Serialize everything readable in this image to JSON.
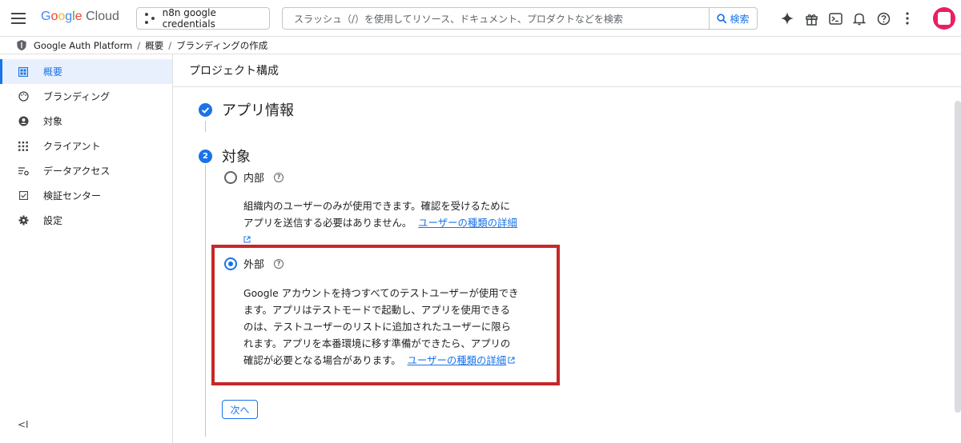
{
  "topbar": {
    "logo_google": "Google",
    "logo_cloud": "Cloud",
    "project": "n8n google credentials",
    "search_placeholder": "スラッシュ（/）を使用してリソース、ドキュメント、プロダクトなどを検索",
    "search_button": "検索"
  },
  "breadcrumb": [
    "Google Auth Platform",
    "概要",
    "ブランディングの作成"
  ],
  "sidebar": {
    "items": [
      {
        "label": "概要",
        "icon": "dashboard-icon"
      },
      {
        "label": "ブランディング",
        "icon": "palette-icon"
      },
      {
        "label": "対象",
        "icon": "person-icon"
      },
      {
        "label": "クライアント",
        "icon": "apps-grid-icon"
      },
      {
        "label": "データアクセス",
        "icon": "data-settings-icon"
      },
      {
        "label": "検証センター",
        "icon": "check-box-icon"
      },
      {
        "label": "設定",
        "icon": "gear-icon"
      }
    ],
    "collapse": "<I"
  },
  "main": {
    "header": "プロジェクト構成",
    "step1": {
      "title": "アプリ情報"
    },
    "step2": {
      "number": "2",
      "title": "対象"
    },
    "internal": {
      "label": "内部",
      "desc_1": "組織内のユーザーのみが使用できます。確認を受けるために",
      "desc_2": "アプリを送信する必要はありません。",
      "link": "ユーザーの種類の詳細"
    },
    "external": {
      "label": "外部",
      "desc_1": "Google アカウントを持つすべてのテストユーザーが使用でき",
      "desc_2": "ます。アプリはテストモードで起動し、アプリを使用できる",
      "desc_3": "のは、テストユーザーのリストに追加されたユーザーに限ら",
      "desc_4": "れます。アプリを本番環境に移す準備ができたら、アプリの",
      "desc_5": "確認が必要となる場合があります。",
      "link": "ユーザーの種類の詳細"
    },
    "next_button": "次へ"
  },
  "colors": {
    "accent": "#1a73e8",
    "highlight": "#c62828",
    "avatar": "#e91e63"
  }
}
